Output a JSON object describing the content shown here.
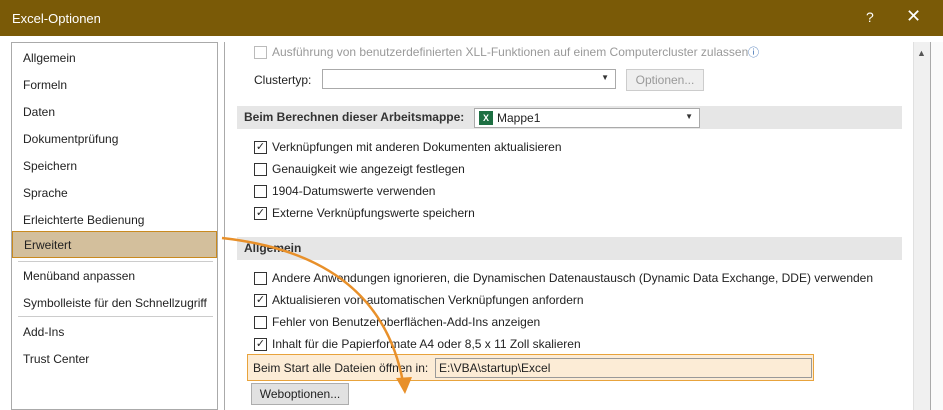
{
  "window": {
    "title": "Excel-Optionen",
    "help": "?",
    "close": "✕"
  },
  "sidebar": {
    "items": [
      {
        "label": "Allgemein"
      },
      {
        "label": "Formeln"
      },
      {
        "label": "Daten"
      },
      {
        "label": "Dokumentprüfung"
      },
      {
        "label": "Speichern"
      },
      {
        "label": "Sprache"
      },
      {
        "label": "Erleichterte Bedienung"
      },
      {
        "label": "Erweitert",
        "active": true
      },
      {
        "label": "Menüband anpassen"
      },
      {
        "label": "Symbolleiste für den Schnellzugriff"
      },
      {
        "label": "Add-Ins"
      },
      {
        "label": "Trust Center"
      }
    ]
  },
  "top": {
    "xll_label": "Ausführung von benutzerdefinierten XLL-Funktionen auf einem Computercluster zulassen",
    "info_icon": "ⓘ",
    "clustertyp_label": "Clustertyp:",
    "clustertyp_value": "",
    "optionen_button": "Optionen..."
  },
  "calc_section": {
    "header": "Beim Berechnen dieser Arbeitsmappe:",
    "workbook": "Mappe1",
    "excel_icon_letter": "X",
    "options": [
      {
        "label": "Verknüpfungen mit anderen Dokumenten aktualisieren",
        "checked": true
      },
      {
        "label": "Genauigkeit wie angezeigt festlegen",
        "checked": false
      },
      {
        "label": "1904-Datumswerte verwenden",
        "checked": false
      },
      {
        "label": "Externe Verknüpfungswerte speichern",
        "checked": true
      }
    ]
  },
  "general_section": {
    "header": "Allgemein",
    "options": [
      {
        "label": "Andere Anwendungen ignorieren, die Dynamischen Datenaustausch (Dynamic Data Exchange, DDE) verwenden",
        "checked": false
      },
      {
        "label": "Aktualisieren von automatischen Verknüpfungen anfordern",
        "checked": true
      },
      {
        "label": "Fehler von Benutzeroberflächen-Add-Ins anzeigen",
        "checked": false
      },
      {
        "label": "Inhalt für die Papierformate A4 oder 8,5 x 11 Zoll skalieren",
        "checked": true
      }
    ],
    "startup_label": "Beim Start alle Dateien öffnen in:",
    "startup_value": "E:\\VBA\\startup\\Excel",
    "weboptionen_button": "Weboptionen..."
  },
  "colors": {
    "titlebar": "#7a5a07",
    "accent": "#e8a33c",
    "active_nav": "#d3bf9c",
    "arrow": "#e8902a"
  }
}
